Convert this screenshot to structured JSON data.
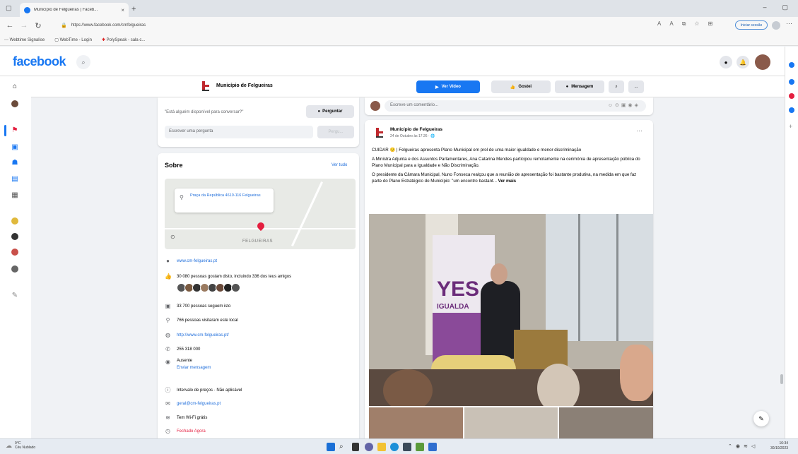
{
  "browser": {
    "tab_title": "Município de Felgueiras | Faceb...",
    "url": "https://www.facebook.com/cmfelgueiras",
    "signin_label": "Iniciar sessão",
    "bookmarks": [
      "Webtime Signalise",
      "WebTime - Login",
      "PolySpeak - sala c..."
    ]
  },
  "fb": {
    "logo": "facebook",
    "page_name": "Município de Felgueiras",
    "buttons": {
      "video": "Ver Vídeo",
      "like": "Gostei",
      "message": "Mensagem",
      "more": "..."
    }
  },
  "ask": {
    "question": "\"Está alguém disponível para conversar?\"",
    "ask_button": "Perguntar",
    "placeholder": "Escrever uma pergunta",
    "send": "Pergu..."
  },
  "about": {
    "title": "Sobre",
    "see_all": "Ver tudo",
    "map_address": "Praça da República 4610-116 Felgueiras",
    "map_label": "FELGUEIRAS",
    "website": "www.cm-felgueiras.pt",
    "likes": "30 080 pessoas gostam disto, incluindo 336 dos teus amigos",
    "followers": "33 700 pessoas seguem isto",
    "visited": "766 pessoas visitaram este local",
    "url2": "http://www.cm-felgueiras.pt/",
    "phone": "255 318 000",
    "away": "Ausente",
    "send_message": "Enviar mensagem",
    "price": "Intervalo de preços · Não aplicável",
    "email": "geral@cm-felgueiras.pt",
    "wifi": "Tem Wi-Fi grátis",
    "closed": "Fechado Agora"
  },
  "comment": {
    "placeholder": "Escreve um comentário..."
  },
  "post": {
    "author": "Município de Felgueiras",
    "date": "24 de Outubro às 17:26 · ",
    "p1": "CUIDAR 🙂 | Felgueiras apresenta Plano Municipal em prol de uma maior igualdade e menor discriminação",
    "p2": "A Ministra Adjunta e dos Assuntos Parlamentares, Ana Catarina Mendes participou remotamente na cerimónia de apresentação pública do Plano Municipal para a Igualdade e Não Discriminação.",
    "p3": "O presidente da Câmara Municipal, Nuno Fonseca realçou que a reunião de apresentação foi bastante produtiva, na medida em que faz parte do Plano Estratégico do Município: \"um encontro bastant...",
    "see_more": "Ver mais",
    "poster_text": "YES",
    "poster_sub": "IGUALDA"
  },
  "taskbar": {
    "weather_temp": "9°C",
    "weather_desc": "Céu Nublado",
    "time": "16:34",
    "date": "30/10/2023"
  },
  "colors": {
    "fb_blue": "#1877f2",
    "link_blue": "#216fdb",
    "closed_red": "#e41e3f"
  }
}
